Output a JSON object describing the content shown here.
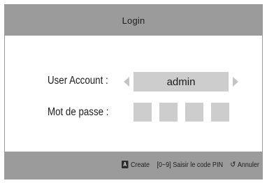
{
  "dialog": {
    "title": "Login",
    "user_account_label": "User Account :",
    "password_label": "Mot de passe :",
    "account_value": "admin",
    "pin_slots": [
      "",
      "",
      "",
      ""
    ]
  },
  "footer": {
    "create_key": "A",
    "create_label": "Create",
    "pin_hint": "[0~9] Saisir le code PIN",
    "return_icon": "return-icon",
    "cancel_label": "Annuler"
  }
}
